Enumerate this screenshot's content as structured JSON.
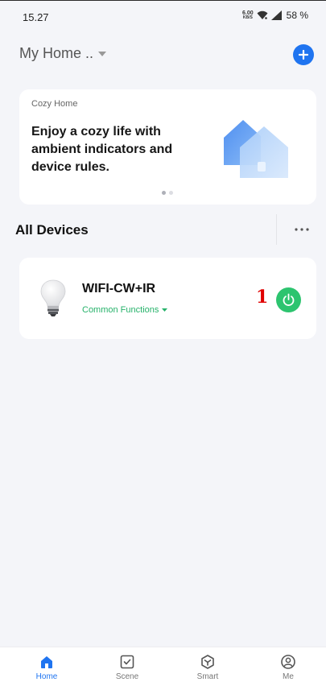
{
  "status_bar": {
    "time": "15.27",
    "net_speed_value": "6.00",
    "net_speed_unit": "KB/S",
    "battery": "58 %"
  },
  "header": {
    "home_name": "My Home ..",
    "add_icon": "plus-icon"
  },
  "banner": {
    "tag": "Cozy Home",
    "text": "Enjoy a cozy life with ambient indicators and device rules.",
    "dots_total": 2,
    "active_dot": 0
  },
  "devices_section": {
    "title": "All Devices",
    "more_icon": "more-dots-icon"
  },
  "device": {
    "name": "WIFI-CW+IR",
    "function_label": "Common Functions",
    "annotation_number": "1",
    "power_icon": "power-icon"
  },
  "bottom_nav": {
    "items": [
      {
        "label": "Home",
        "icon": "home-icon",
        "active": true
      },
      {
        "label": "Scene",
        "icon": "scene-check-icon",
        "active": false
      },
      {
        "label": "Smart",
        "icon": "smart-cube-icon",
        "active": false
      },
      {
        "label": "Me",
        "icon": "profile-icon",
        "active": false
      }
    ]
  },
  "colors": {
    "accent": "#1f74f0",
    "power_green": "#2dc46f",
    "function_green": "#26b26a",
    "background": "#f4f5f9"
  }
}
